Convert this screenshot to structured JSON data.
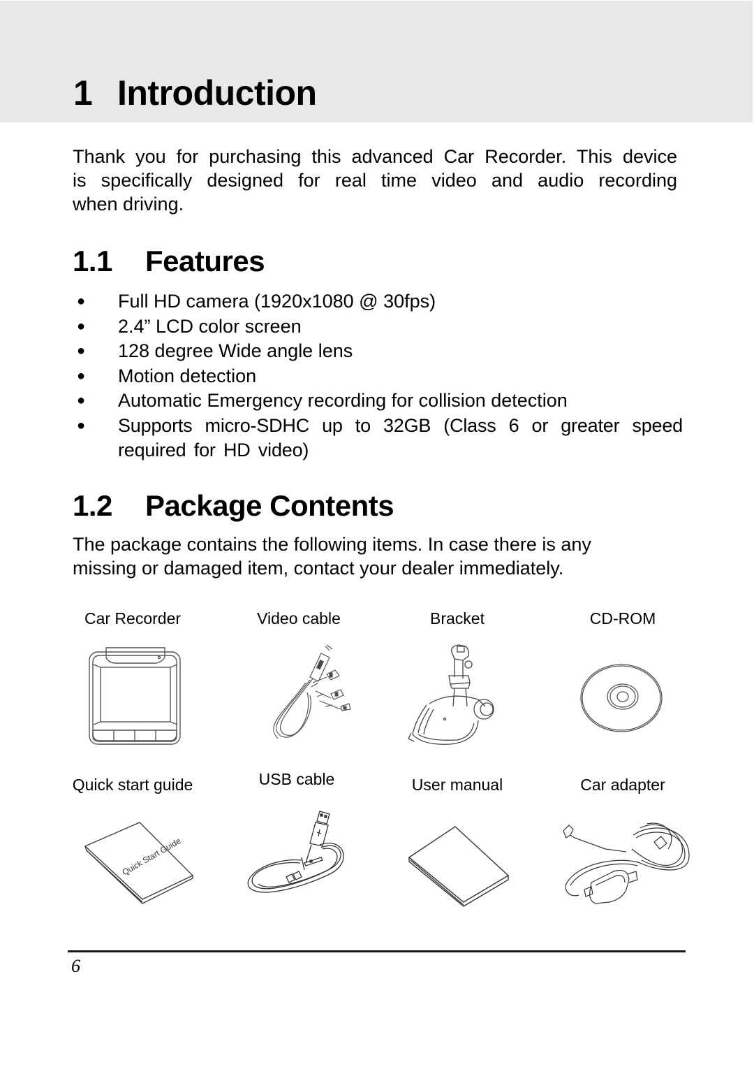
{
  "chapter": {
    "number": "1",
    "title": "Introduction"
  },
  "intro": {
    "lines": [
      "Thank you for purchasing this advanced Car Recorder. This device",
      "is specifically designed for real time video and audio recording",
      "when driving."
    ]
  },
  "features": {
    "number": "1.1",
    "title": "Features",
    "items": [
      "Full HD camera (1920x1080 @ 30fps)",
      "2.4” LCD color screen",
      "128 degree Wide angle lens",
      "Motion detection",
      "Automatic Emergency recording for collision detection",
      "Supports micro-SDHC up to 32GB (Class 6 or greater speed required for HD video)"
    ]
  },
  "package": {
    "number": "1.2",
    "title": "Package Contents",
    "description_lines": [
      "The package contains the following items. In case there is any",
      "missing or damaged item, contact your dealer immediately."
    ],
    "items": [
      {
        "label": "Car Recorder",
        "icon": "car-recorder-icon"
      },
      {
        "label": "Video cable",
        "icon": "video-cable-icon"
      },
      {
        "label": "Bracket",
        "icon": "bracket-icon"
      },
      {
        "label": "CD-ROM",
        "icon": "cd-rom-icon"
      },
      {
        "label": "Quick start guide",
        "icon": "quick-start-guide-icon",
        "cover_text": "Quick Start Guide"
      },
      {
        "label": "USB cable",
        "icon": "usb-cable-icon"
      },
      {
        "label": "User manual",
        "icon": "user-manual-icon"
      },
      {
        "label": "Car adapter",
        "icon": "car-adapter-icon"
      }
    ]
  },
  "footer": {
    "page_number": "6"
  }
}
